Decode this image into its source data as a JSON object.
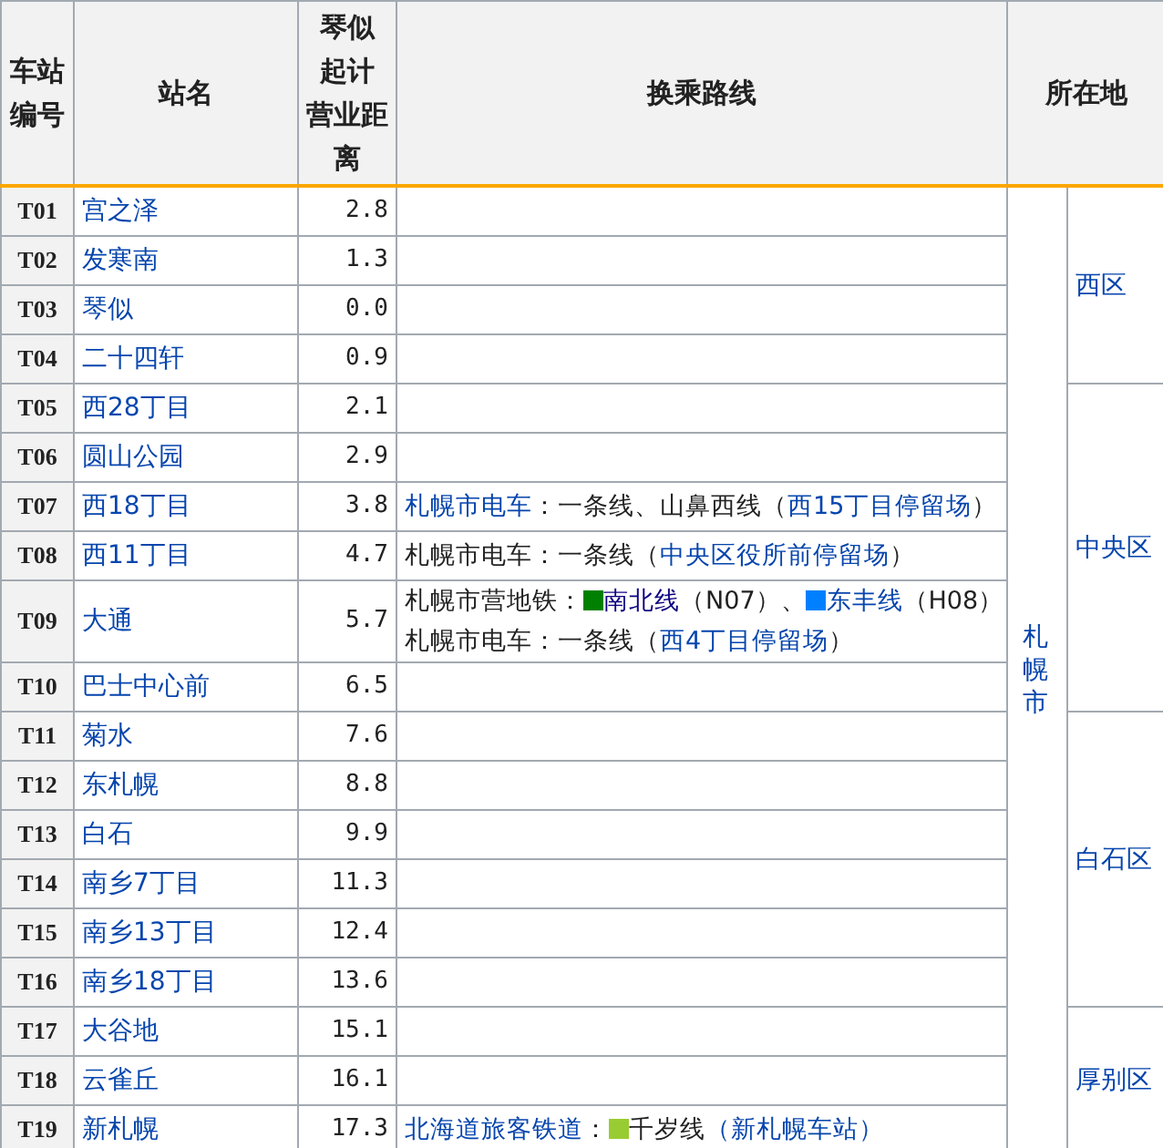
{
  "table": {
    "columns": [
      {
        "label": "车站编号"
      },
      {
        "label": "站名"
      },
      {
        "lines": [
          "琴似",
          "起计",
          "营业距离"
        ]
      },
      {
        "label": "换乘路线"
      },
      {
        "label": "所在地"
      }
    ],
    "cities": [
      {
        "name": "札幌市",
        "wards": [
          {
            "name": "西区",
            "stations": [
              {
                "code": "T01",
                "name": "宫之泽",
                "distance": "2.8"
              },
              {
                "code": "T02",
                "name": "发寒南",
                "distance": "1.3"
              },
              {
                "code": "T03",
                "name": "琴似",
                "distance": "0.0"
              },
              {
                "code": "T04",
                "name": "二十四轩",
                "distance": "0.9"
              }
            ]
          },
          {
            "name": "中央区",
            "stations": [
              {
                "code": "T05",
                "name": "西28丁目",
                "distance": "2.1"
              },
              {
                "code": "T06",
                "name": "圆山公园",
                "distance": "2.9"
              },
              {
                "code": "T07",
                "name": "西18丁目",
                "distance": "3.8",
                "transfers": [
                  [
                    {
                      "kind": "link",
                      "text": "札幌市电车"
                    },
                    {
                      "kind": "text",
                      "text": "：一条线、山鼻西线（"
                    },
                    {
                      "kind": "link",
                      "text": "西15丁目停留场"
                    },
                    {
                      "kind": "text",
                      "text": "）"
                    }
                  ]
                ]
              },
              {
                "code": "T08",
                "name": "西11丁目",
                "distance": "4.7",
                "transfers": [
                  [
                    {
                      "kind": "text",
                      "text": "札幌市电车：一条线（"
                    },
                    {
                      "kind": "link",
                      "text": "中央区役所前停留场"
                    },
                    {
                      "kind": "text",
                      "text": "）"
                    }
                  ]
                ]
              },
              {
                "code": "T09",
                "name": "大通",
                "distance": "5.7",
                "transfers": [
                  [
                    {
                      "kind": "text",
                      "text": "札幌市营地铁："
                    },
                    {
                      "kind": "swatch",
                      "color": "#008000"
                    },
                    {
                      "kind": "visited",
                      "text": "南北线"
                    },
                    {
                      "kind": "text",
                      "text": "（N07）、"
                    },
                    {
                      "kind": "swatch",
                      "color": "#0080ff"
                    },
                    {
                      "kind": "link",
                      "text": "东丰线"
                    },
                    {
                      "kind": "text",
                      "text": "（H08）"
                    }
                  ],
                  [
                    {
                      "kind": "text",
                      "text": "札幌市电车：一条线（"
                    },
                    {
                      "kind": "link",
                      "text": "西4丁目停留场"
                    },
                    {
                      "kind": "text",
                      "text": "）"
                    }
                  ]
                ]
              },
              {
                "code": "T10",
                "name": "巴士中心前",
                "distance": "6.5"
              }
            ]
          },
          {
            "name": "白石区",
            "stations": [
              {
                "code": "T11",
                "name": "菊水",
                "distance": "7.6"
              },
              {
                "code": "T12",
                "name": "东札幌",
                "distance": "8.8"
              },
              {
                "code": "T13",
                "name": "白石",
                "distance": "9.9"
              },
              {
                "code": "T14",
                "name": "南乡7丁目",
                "distance": "11.3"
              },
              {
                "code": "T15",
                "name": "南乡13丁目",
                "distance": "12.4"
              },
              {
                "code": "T16",
                "name": "南乡18丁目",
                "distance": "13.6"
              }
            ]
          },
          {
            "name": "厚别区",
            "stations": [
              {
                "code": "T17",
                "name": "大谷地",
                "distance": "15.1"
              },
              {
                "code": "T18",
                "name": "云雀丘",
                "distance": "16.1"
              },
              {
                "code": "T19",
                "name": "新札幌",
                "distance": "17.3",
                "transfers": [
                  [
                    {
                      "kind": "link",
                      "text": "北海道旅客铁道"
                    },
                    {
                      "kind": "text",
                      "text": "："
                    },
                    {
                      "kind": "swatch",
                      "color": "#99cc33"
                    },
                    {
                      "kind": "text",
                      "text": "千岁线"
                    },
                    {
                      "kind": "link",
                      "text": "（新札幌车站）"
                    }
                  ]
                ]
              }
            ]
          }
        ]
      }
    ]
  }
}
